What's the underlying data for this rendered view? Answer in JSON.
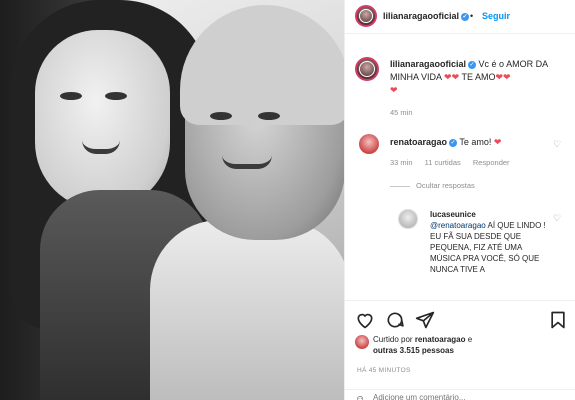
{
  "header": {
    "username": "lilianaragaooficial",
    "separator": "•",
    "follow_label": "Seguir"
  },
  "caption": {
    "username": "lilianaragaooficial",
    "text": "Vc é o AMOR DA MINHA VIDA",
    "text2": "TE AMO",
    "hearts_a": "❤❤",
    "hearts_b": "❤❤",
    "heart_end": "❤",
    "time": "45 min"
  },
  "comments": [
    {
      "username": "renatoaragao",
      "text": "Te amo!",
      "heart": "❤",
      "time": "33 min",
      "likes": "11 curtidas",
      "reply_label": "Responder"
    }
  ],
  "hide_replies_label": "Ocultar respostas",
  "reply": {
    "username": "lucaseunice",
    "mention": "@renatoaragao",
    "text": "AÍ QUE LINDO ! EU FÃ SUA DESDE QUE PEQUENA, FIZ ATÉ UMA MÚSICA PRA VOCÊ, SÓ QUE NUNCA TIVE A"
  },
  "liked_by": {
    "prefix": "Curtido por",
    "user": "renatoaragao",
    "joiner": "e",
    "others": "outras 3.515 pessoas"
  },
  "time_ago": "HÁ 45 MINUTOS",
  "add_comment_placeholder": "Adicione um comentário...",
  "icons": [
    "verified-icon",
    "like-icon",
    "comment-icon",
    "share-icon",
    "save-icon",
    "smiley-icon"
  ],
  "colors": {
    "accent_blue": "#0095f6",
    "heart_red": "#ed4956",
    "verified_blue": "#3897f0"
  }
}
